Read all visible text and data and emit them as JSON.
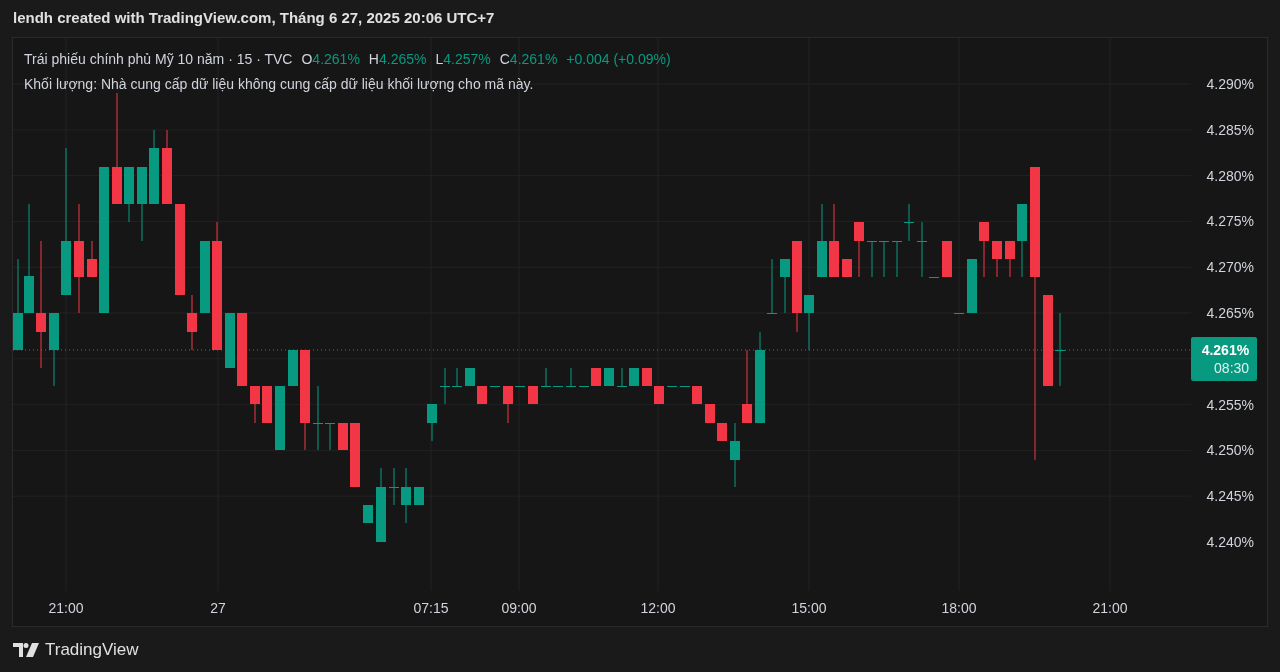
{
  "header": {
    "caption": "lendh created with TradingView.com, Tháng 6 27, 2025 20:06 UTC+7"
  },
  "legend": {
    "symbol": "Trái phiếu chính phủ Mỹ 10 năm · 15 · TVC",
    "values": [
      {
        "label": "O",
        "value": "4.261%"
      },
      {
        "label": "H",
        "value": "4.265%"
      },
      {
        "label": "L",
        "value": "4.257%"
      },
      {
        "label": "C",
        "value": "4.261%"
      }
    ],
    "change": "+0.004 (+0.09%)",
    "volume_note": "Khối lượng: Nhà cung cấp dữ liệu không cung cấp dữ liệu khối lượng cho mã này."
  },
  "price_axis": {
    "ticks": [
      "4.290%",
      "4.285%",
      "4.280%",
      "4.275%",
      "4.270%",
      "4.265%",
      "4.255%",
      "4.250%",
      "4.245%",
      "4.240%"
    ],
    "last_price": {
      "price": "4.261%",
      "countdown": "08:30"
    }
  },
  "time_axis": {
    "ticks": [
      "21:00",
      "27",
      "07:15",
      "09:00",
      "12:00",
      "15:00",
      "18:00",
      "21:00"
    ]
  },
  "footer": {
    "brand": "TradingView"
  }
}
